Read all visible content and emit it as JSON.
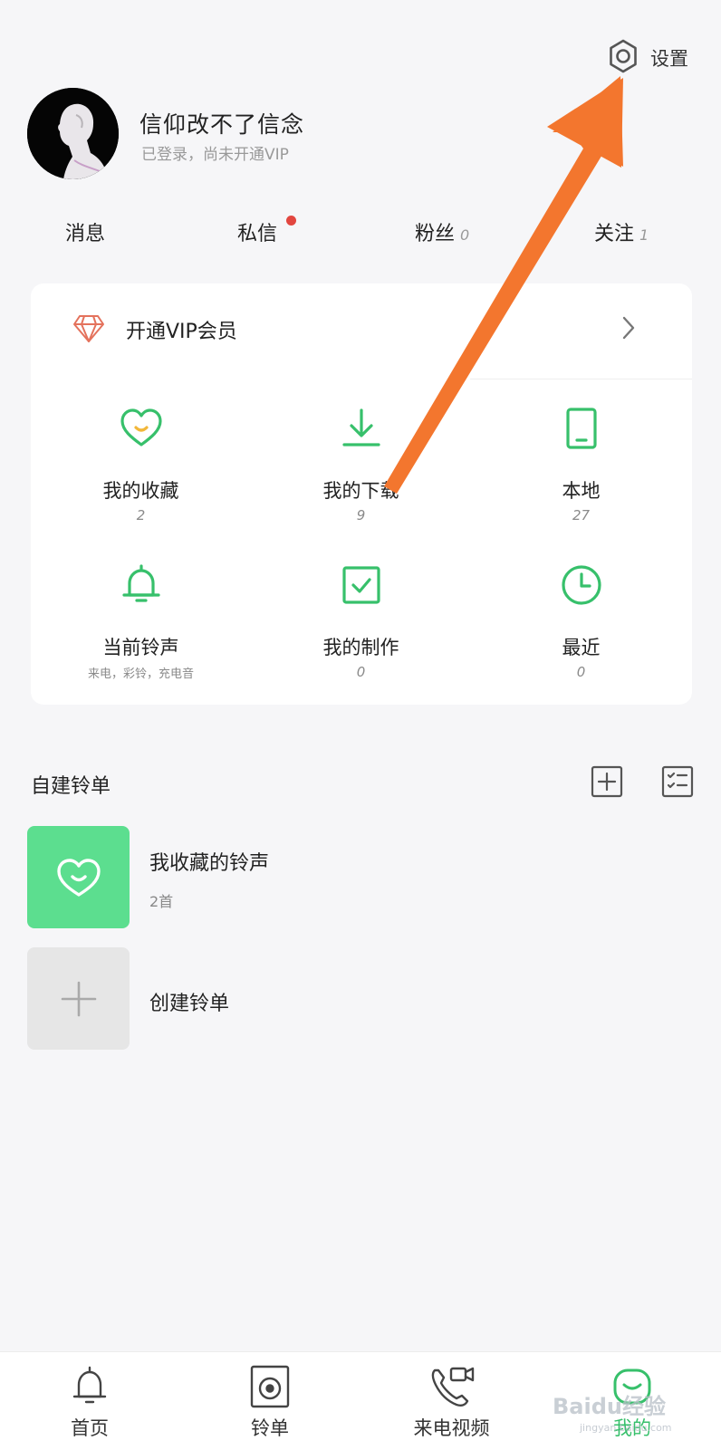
{
  "header": {
    "settings_label": "设置",
    "username": "信仰改不了信念",
    "user_status": "已登录，尚未开通VIP"
  },
  "stats": [
    {
      "label": "消息",
      "count": ""
    },
    {
      "label": "私信",
      "count": ""
    },
    {
      "label": "粉丝",
      "count": "0"
    },
    {
      "label": "关注",
      "count": "1"
    }
  ],
  "vip": {
    "label": "开通VIP会员"
  },
  "grid": [
    {
      "label": "我的收藏",
      "value": "2",
      "icon": "heart-smile-icon"
    },
    {
      "label": "我的下载",
      "value": "9",
      "icon": "download-icon"
    },
    {
      "label": "本地",
      "value": "27",
      "icon": "phone-icon"
    },
    {
      "label": "当前铃声",
      "value": "来电，彩铃，充电音",
      "icon": "bell-icon"
    },
    {
      "label": "我的制作",
      "value": "0",
      "icon": "check-box-icon"
    },
    {
      "label": "最近",
      "value": "0",
      "icon": "clock-icon"
    }
  ],
  "playlists": {
    "section_title": "自建铃单",
    "items": [
      {
        "name": "我收藏的铃声",
        "count": "2首"
      },
      {
        "name": "创建铃单"
      }
    ]
  },
  "bottom_nav": [
    {
      "label": "首页",
      "icon": "bell-icon"
    },
    {
      "label": "铃单",
      "icon": "disc-icon"
    },
    {
      "label": "来电视频",
      "icon": "phone-video-icon"
    },
    {
      "label": "我的",
      "icon": "profile-icon",
      "active": true
    }
  ],
  "watermark": {
    "text": "Baidu经验",
    "sub": "jingyan.baidu.com"
  },
  "colors": {
    "accent": "#37c06b",
    "playlist_green": "#5cde8f",
    "annotation_arrow": "#f3762e",
    "badge_red": "#e2463f"
  }
}
